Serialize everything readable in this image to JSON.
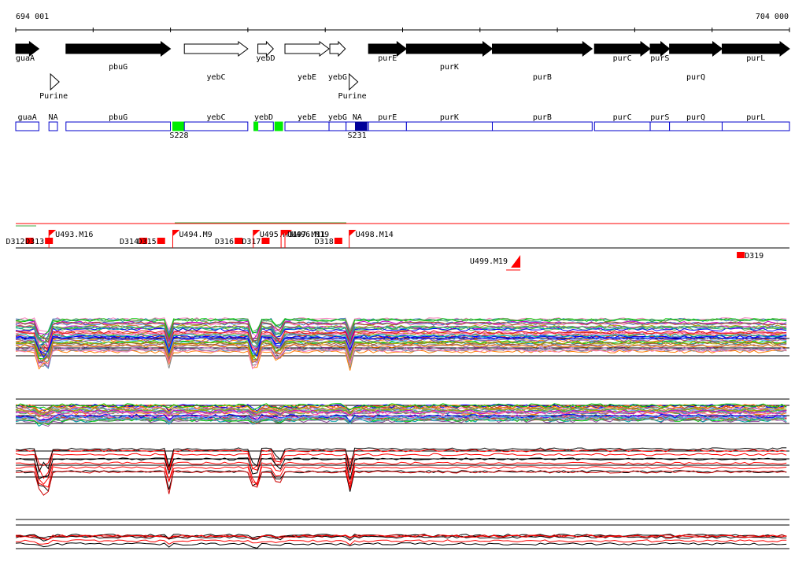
{
  "coordinates": {
    "start": "694 001",
    "end": "704 000"
  },
  "genes": [
    {
      "label": "guaA",
      "strand": "+",
      "filled": true,
      "start": 694001,
      "end": 694300
    },
    {
      "label": "pbuG",
      "strand": "+",
      "filled": true,
      "start": 694650,
      "end": 696000
    },
    {
      "label": "yebC",
      "strand": "+",
      "filled": false,
      "start": 696180,
      "end": 697000
    },
    {
      "label": "yebD",
      "strand": "+",
      "filled": false,
      "start": 697130,
      "end": 697330
    },
    {
      "label": "yebE",
      "strand": "+",
      "filled": false,
      "start": 697480,
      "end": 698050
    },
    {
      "label": "yebG",
      "strand": "+",
      "filled": false,
      "start": 698060,
      "end": 698260
    },
    {
      "label": "purE",
      "strand": "+",
      "filled": true,
      "start": 698560,
      "end": 699050
    },
    {
      "label": "purK",
      "strand": "+",
      "filled": true,
      "start": 699050,
      "end": 700160
    },
    {
      "label": "purB",
      "strand": "+",
      "filled": true,
      "start": 700160,
      "end": 701450
    },
    {
      "label": "purC",
      "strand": "+",
      "filled": true,
      "start": 701480,
      "end": 702200
    },
    {
      "label": "purS",
      "strand": "+",
      "filled": true,
      "start": 702200,
      "end": 702450
    },
    {
      "label": "purQ",
      "strand": "+",
      "filled": true,
      "start": 702450,
      "end": 703130
    },
    {
      "label": "purL",
      "strand": "+",
      "filled": true,
      "start": 703130,
      "end": 704000
    }
  ],
  "riboswitches": [
    {
      "label": "Purine",
      "pos": 694450
    },
    {
      "label": "Purine",
      "pos": 698310
    }
  ],
  "annotation_boxes": [
    {
      "label": "guaA",
      "start": 694001,
      "end": 694300,
      "color": "",
      "fill": "#ffffff"
    },
    {
      "label": "NA",
      "start": 694430,
      "end": 694540,
      "color": "",
      "fill": "#ffffff"
    },
    {
      "label": "pbuG",
      "start": 694650,
      "end": 696000,
      "color": "",
      "fill": "#ffffff"
    },
    {
      "label": "",
      "start": 696030,
      "end": 696180,
      "color": "#00ee00",
      "fill": "#00ee00"
    },
    {
      "label": "yebC",
      "start": 696180,
      "end": 697000,
      "color": "",
      "fill": "#ffffff"
    },
    {
      "label": "yebD",
      "start": 697080,
      "end": 697330,
      "color": "",
      "fill": "#ffffff"
    },
    {
      "label": "",
      "start": 697080,
      "end": 697130,
      "color": "#00ee00",
      "fill": "#00ee00"
    },
    {
      "label": "",
      "start": 697350,
      "end": 697450,
      "color": "#00ee00",
      "fill": "#00ee00"
    },
    {
      "label": "yebE",
      "start": 697480,
      "end": 698050,
      "color": "",
      "fill": "#ffffff"
    },
    {
      "label": "yebG",
      "start": 698050,
      "end": 698270,
      "color": "",
      "fill": "#ffffff"
    },
    {
      "label": "NA",
      "start": 698270,
      "end": 698560,
      "color": "",
      "fill": "#ffffff"
    },
    {
      "label": "",
      "start": 698390,
      "end": 698540,
      "color": "#000099",
      "fill": "#000099"
    },
    {
      "label": "purE",
      "start": 698560,
      "end": 699050,
      "color": "",
      "fill": "#ffffff"
    },
    {
      "label": "purK",
      "start": 699050,
      "end": 700160,
      "color": "",
      "fill": "#ffffff"
    },
    {
      "label": "purB",
      "start": 700160,
      "end": 701450,
      "color": "",
      "fill": "#ffffff"
    },
    {
      "label": "purC",
      "start": 701480,
      "end": 702200,
      "color": "",
      "fill": "#ffffff"
    },
    {
      "label": "purS",
      "start": 702200,
      "end": 702450,
      "color": "",
      "fill": "#ffffff"
    },
    {
      "label": "purQ",
      "start": 702450,
      "end": 703130,
      "color": "",
      "fill": "#ffffff"
    },
    {
      "label": "purL",
      "start": 703130,
      "end": 704000,
      "color": "",
      "fill": "#ffffff"
    }
  ],
  "annotation_tags": [
    {
      "label": "S228",
      "pos": 696030
    },
    {
      "label": "S231",
      "pos": 698330
    }
  ],
  "segment_markers": [
    {
      "label": "D312",
      "pos": 694180
    },
    {
      "label": "D313",
      "pos": 694430
    },
    {
      "label": "D314",
      "pos": 695650
    },
    {
      "label": "D315",
      "pos": 695880
    },
    {
      "label": "D316",
      "pos": 696880
    },
    {
      "label": "D317",
      "pos": 697230
    },
    {
      "label": "D318",
      "pos": 698170
    },
    {
      "label": "D319",
      "pos": 703370
    }
  ],
  "upstream_markers": [
    {
      "label": "U493.M16",
      "pos": 694430
    },
    {
      "label": "U494.M9",
      "pos": 696030
    },
    {
      "label": "U495.M11",
      "pos": 697070
    },
    {
      "label": "U496.M19",
      "pos": 697480
    },
    {
      "label": "U497.M11",
      "pos": 697430
    },
    {
      "label": "U498.M14",
      "pos": 698310
    },
    {
      "label": "U499.M19",
      "pos": 700400
    }
  ],
  "colors": {
    "gene_fill": "#000000",
    "gene_empty": "#ffffff",
    "box_stroke": "#0000cc",
    "marker": "#ff0000",
    "axis": "#000000"
  }
}
